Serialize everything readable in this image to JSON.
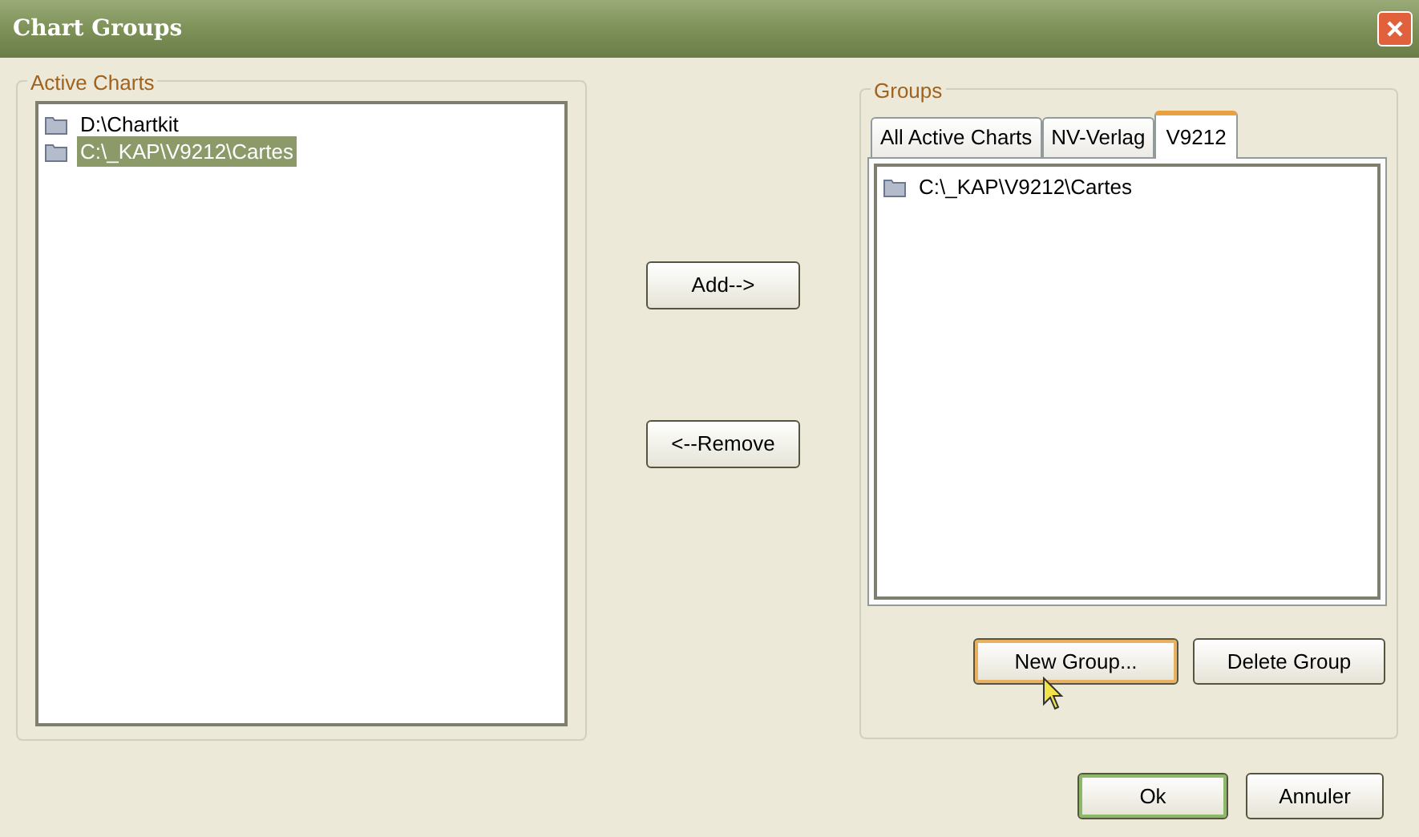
{
  "window": {
    "title": "Chart Groups"
  },
  "active_charts": {
    "title": "Active Charts",
    "items": [
      {
        "label": "D:\\Chartkit",
        "selected": false
      },
      {
        "label": "C:\\_KAP\\V9212\\Cartes",
        "selected": true
      }
    ]
  },
  "move_buttons": [
    {
      "label": "Add-->"
    },
    {
      "label": "<--Remove"
    }
  ],
  "groups": {
    "title": "Groups",
    "tabs": [
      {
        "label": "All Active Charts",
        "selected": false
      },
      {
        "label": "NV-Verlag",
        "selected": false
      },
      {
        "label": "V9212",
        "selected": true
      }
    ],
    "items": [
      {
        "label": "C:\\_KAP\\V9212\\Cartes",
        "selected": false
      }
    ],
    "buttons": [
      {
        "label": "New Group...",
        "hovered": true
      },
      {
        "label": "Delete Group",
        "hovered": false
      }
    ]
  },
  "buttons": [
    {
      "label": "Ok",
      "default": true
    },
    {
      "label": "Annuler",
      "default": false
    }
  ]
}
